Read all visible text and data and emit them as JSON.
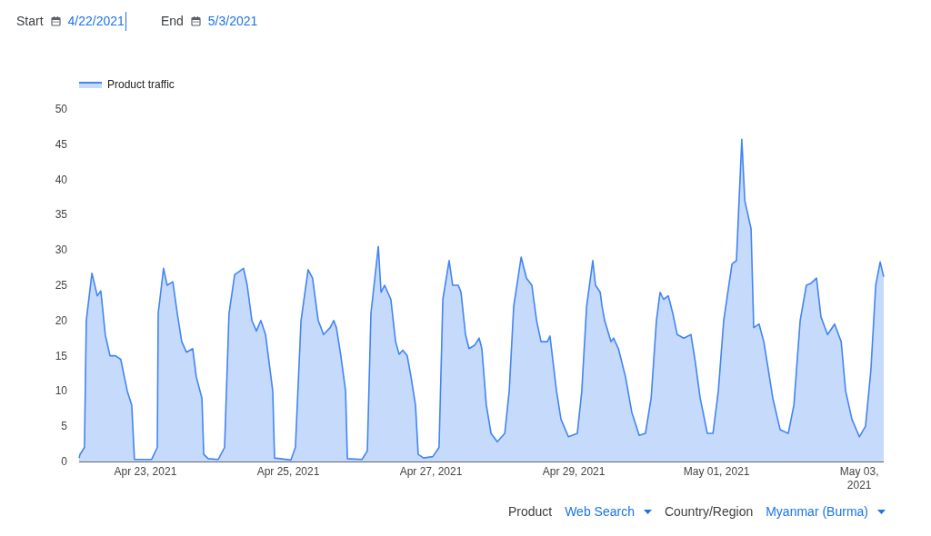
{
  "date_range": {
    "start_label": "Start",
    "start_value": "4/22/2021",
    "start_focused": true,
    "end_label": "End",
    "end_value": "5/3/2021"
  },
  "chart": {
    "chart_data": {
      "type": "area",
      "xlim": [
        "2021-04-22T01:42",
        "2021-05-03T08:12"
      ],
      "ylim": [
        0,
        50
      ],
      "yticks": [
        0,
        5,
        10,
        15,
        20,
        25,
        30,
        35,
        40,
        45,
        50
      ],
      "xticks": [
        {
          "value": "2021-04-23T00:00",
          "label": "Apr 23, 2021"
        },
        {
          "value": "2021-04-25T00:00",
          "label": "Apr 25, 2021"
        },
        {
          "value": "2021-04-27T00:00",
          "label": "Apr 27, 2021"
        },
        {
          "value": "2021-04-29T00:00",
          "label": "Apr 29, 2021"
        },
        {
          "value": "2021-05-01T00:00",
          "label": "May 01, 2021"
        },
        {
          "value": "2021-05-03T00:00",
          "label": "May 03, 2021"
        }
      ],
      "x": [
        "2021-04-22T01:42",
        "2021-04-22T02:00",
        "2021-04-22T03:30",
        "2021-04-22T04:06",
        "2021-04-22T06:00",
        "2021-04-22T07:48",
        "2021-04-22T09:00",
        "2021-04-22T10:30",
        "2021-04-22T12:06",
        "2021-04-22T13:54",
        "2021-04-22T15:42",
        "2021-04-22T17:54",
        "2021-04-22T19:24",
        "2021-04-22T20:18",
        "2021-04-23T02:06",
        "2021-04-23T04:00",
        "2021-04-23T04:18",
        "2021-04-23T06:06",
        "2021-04-23T07:18",
        "2021-04-23T09:12",
        "2021-04-23T10:42",
        "2021-04-23T12:12",
        "2021-04-23T13:48",
        "2021-04-23T15:54",
        "2021-04-23T17:06",
        "2021-04-23T19:00",
        "2021-04-23T19:36",
        "2021-04-23T21:06",
        "2021-04-24T00:30",
        "2021-04-24T02:36",
        "2021-04-24T04:06",
        "2021-04-24T06:00",
        "2021-04-24T09:00",
        "2021-04-24T10:12",
        "2021-04-24T11:48",
        "2021-04-24T13:18",
        "2021-04-24T14:48",
        "2021-04-24T16:24",
        "2021-04-24T18:48",
        "2021-04-24T19:24",
        "2021-04-25T00:54",
        "2021-04-25T02:24",
        "2021-04-25T04:18",
        "2021-04-25T06:42",
        "2021-04-25T08:12",
        "2021-04-25T10:06",
        "2021-04-25T11:54",
        "2021-04-25T14:06",
        "2021-04-25T15:18",
        "2021-04-25T16:12",
        "2021-04-25T17:42",
        "2021-04-25T19:18",
        "2021-04-25T19:54",
        "2021-04-26T00:48",
        "2021-04-26T02:36",
        "2021-04-26T03:48",
        "2021-04-26T06:18",
        "2021-04-26T07:12",
        "2021-04-26T08:24",
        "2021-04-26T10:30",
        "2021-04-26T12:06",
        "2021-04-26T13:18",
        "2021-04-26T14:30",
        "2021-04-26T16:00",
        "2021-04-26T17:18",
        "2021-04-26T18:48",
        "2021-04-26T19:42",
        "2021-04-26T21:30",
        "2021-04-27T00:36",
        "2021-04-27T02:42",
        "2021-04-27T04:00",
        "2021-04-27T06:06",
        "2021-04-27T07:18",
        "2021-04-27T09:12",
        "2021-04-27T10:06",
        "2021-04-27T11:36",
        "2021-04-27T12:48",
        "2021-04-27T14:42",
        "2021-04-27T16:12",
        "2021-04-27T17:06",
        "2021-04-27T18:36",
        "2021-04-27T20:12",
        "2021-04-27T22:18",
        "2021-04-28T00:48",
        "2021-04-28T02:18",
        "2021-04-28T03:48",
        "2021-04-28T06:18",
        "2021-04-28T08:06",
        "2021-04-28T09:54",
        "2021-04-28T11:30",
        "2021-04-28T13:00",
        "2021-04-28T15:06",
        "2021-04-28T16:00",
        "2021-04-28T18:12",
        "2021-04-28T19:42",
        "2021-04-28T22:12",
        "2021-04-29T01:12",
        "2021-04-29T02:42",
        "2021-04-29T04:18",
        "2021-04-29T06:24",
        "2021-04-29T07:18",
        "2021-04-29T08:54",
        "2021-04-29T09:30",
        "2021-04-29T10:24",
        "2021-04-29T12:30",
        "2021-04-29T13:24",
        "2021-04-29T15:00",
        "2021-04-29T17:24",
        "2021-04-29T19:30",
        "2021-04-29T22:00",
        "2021-04-30T00:06",
        "2021-04-30T02:00",
        "2021-04-30T03:48",
        "2021-04-30T05:00",
        "2021-04-30T06:12",
        "2021-04-30T07:48",
        "2021-04-30T09:18",
        "2021-04-30T10:48",
        "2021-04-30T13:00",
        "2021-04-30T15:24",
        "2021-04-30T16:54",
        "2021-04-30T18:30",
        "2021-04-30T20:54",
        "2021-04-30T22:48",
        "2021-05-01T00:36",
        "2021-05-01T02:24",
        "2021-05-01T05:12",
        "2021-05-01T06:42",
        "2021-05-01T08:30",
        "2021-05-01T09:30",
        "2021-05-01T11:36",
        "2021-05-01T12:30",
        "2021-05-01T14:18",
        "2021-05-01T15:54",
        "2021-05-01T17:24",
        "2021-05-01T18:54",
        "2021-05-01T21:24",
        "2021-05-02T00:06",
        "2021-05-02T02:00",
        "2021-05-02T04:06",
        "2021-05-02T06:12",
        "2021-05-02T07:48",
        "2021-05-02T09:36",
        "2021-05-02T11:06",
        "2021-05-02T13:18",
        "2021-05-02T15:42",
        "2021-05-02T17:54",
        "2021-05-02T19:24",
        "2021-05-02T21:30",
        "2021-05-03T00:00",
        "2021-05-03T02:06",
        "2021-05-03T03:54",
        "2021-05-03T05:30",
        "2021-05-03T07:00",
        "2021-05-03T08:12"
      ],
      "series": [
        {
          "name": "Product traffic",
          "color": "#4285f4",
          "values": [
            0.5,
            1,
            2,
            20,
            26.7,
            23.5,
            24.2,
            18,
            15,
            15,
            14.5,
            10,
            8,
            0.3,
            0.3,
            2,
            21,
            27.4,
            25,
            25.5,
            21,
            17,
            15.5,
            16,
            12,
            9,
            1,
            0.4,
            0.3,
            2,
            21,
            26.5,
            27.4,
            25,
            20,
            18.5,
            20,
            18,
            10,
            0.5,
            0.2,
            2,
            20,
            27.2,
            26,
            20,
            18,
            19,
            20,
            19,
            15,
            10,
            0.4,
            0.3,
            1.5,
            21,
            30.5,
            24,
            25,
            23,
            17,
            15.2,
            15.8,
            15,
            12,
            8,
            1,
            0.5,
            0.7,
            2,
            23,
            28.5,
            25,
            25,
            24,
            18,
            16,
            16.5,
            17.5,
            16,
            8,
            4,
            2.8,
            4,
            10,
            22,
            29,
            26,
            25,
            20,
            17,
            17,
            17.8,
            10,
            6,
            3.5,
            4,
            10,
            22,
            28.5,
            25,
            24,
            22,
            20,
            17,
            17.5,
            16,
            12,
            7,
            3.7,
            4,
            9,
            20,
            24,
            23,
            23.5,
            21,
            18,
            17.5,
            18,
            14,
            9,
            4,
            4,
            10,
            20,
            28,
            28.5,
            45.7,
            37,
            33,
            19,
            19.5,
            17,
            13,
            9,
            4.5,
            4,
            8,
            20,
            25,
            25.3,
            26,
            20.5,
            18,
            19.5,
            17,
            10,
            6,
            3.5,
            5,
            13,
            25,
            28.3,
            26.2
          ]
        }
      ]
    }
  },
  "filters": [
    {
      "label": "Product",
      "value": "Web Search"
    },
    {
      "label": "Country/Region",
      "value": "Myanmar (Burma)"
    }
  ]
}
